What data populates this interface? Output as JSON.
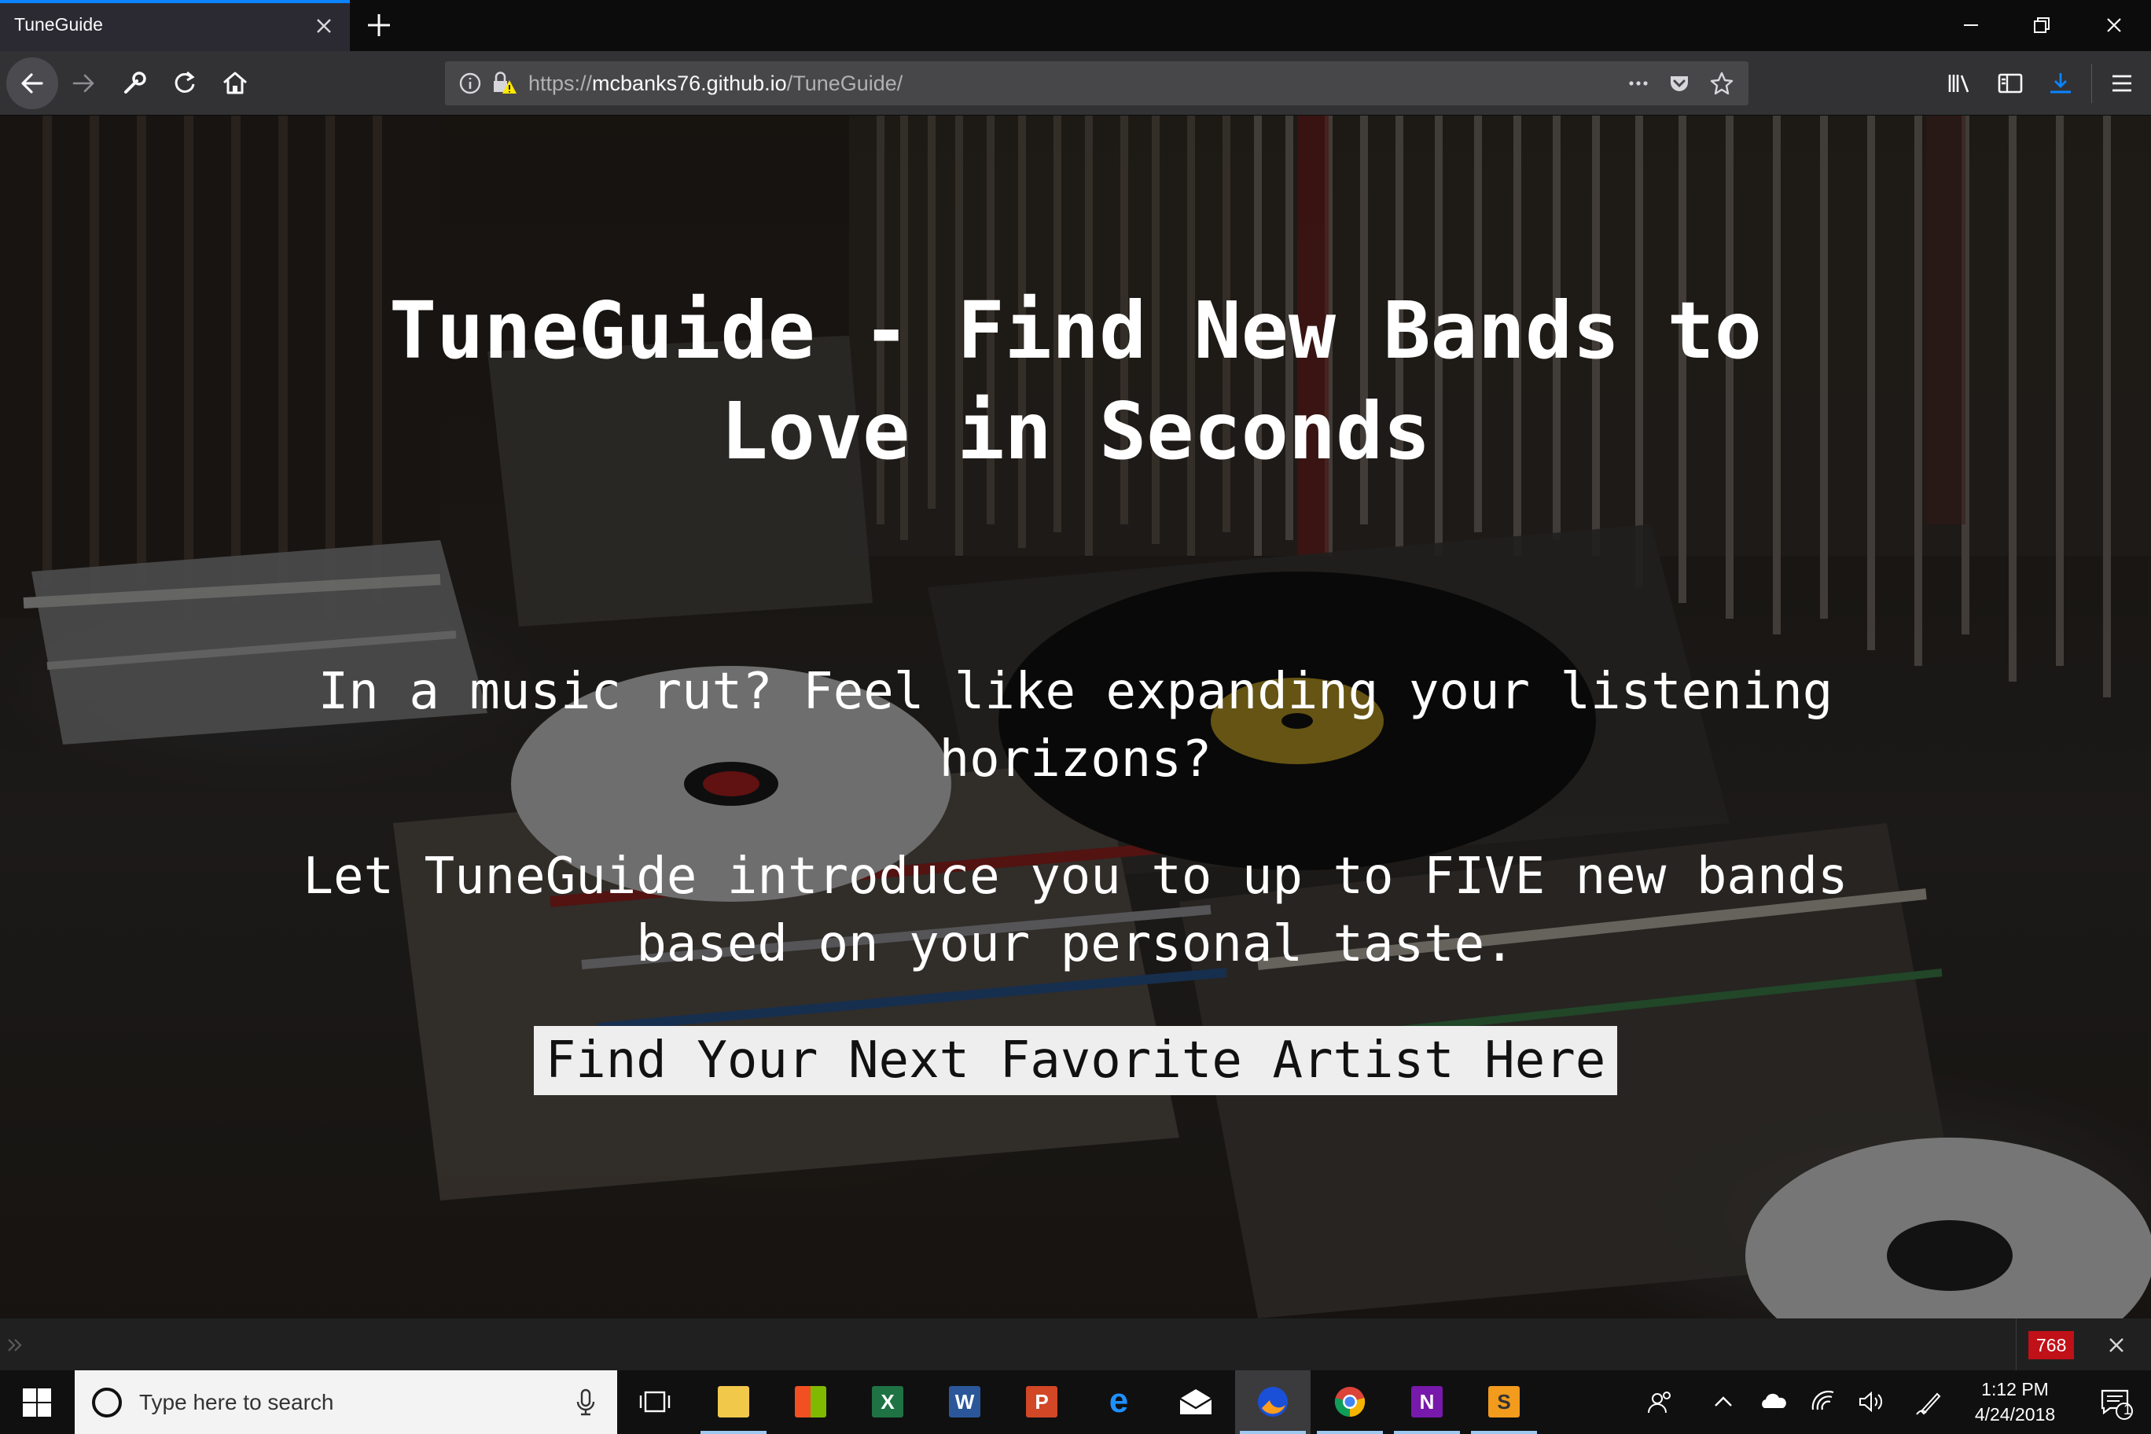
{
  "browser": {
    "tab_title": "TuneGuide",
    "url_scheme": "https://",
    "url_host": "mcbanks76.github.io",
    "url_path": "/TuneGuide/",
    "accent": "#0a84ff"
  },
  "page": {
    "title": "TuneGuide - Find New Bands to Love in Seconds",
    "intro": "In a music rut? Feel like expanding your listening horizons?",
    "pitch": "Let TuneGuide introduce you to up to FIVE new bands based on your personal taste.",
    "cta_label": "Find Your Next Favorite Artist Here"
  },
  "statusbar": {
    "counter": "768"
  },
  "taskbar": {
    "search_placeholder": "Type here to search",
    "time": "1:12 PM",
    "date": "4/24/2018",
    "notification_count": "1",
    "apps": [
      {
        "name": "file-explorer",
        "letter": ""
      },
      {
        "name": "store",
        "letter": ""
      },
      {
        "name": "excel",
        "letter": "X"
      },
      {
        "name": "word",
        "letter": "W"
      },
      {
        "name": "powerpoint",
        "letter": "P"
      },
      {
        "name": "edge",
        "letter": "e"
      },
      {
        "name": "mail",
        "letter": ""
      },
      {
        "name": "firefox",
        "letter": ""
      },
      {
        "name": "chrome",
        "letter": ""
      },
      {
        "name": "onenote",
        "letter": "N"
      },
      {
        "name": "sublime-text",
        "letter": "S"
      }
    ]
  }
}
